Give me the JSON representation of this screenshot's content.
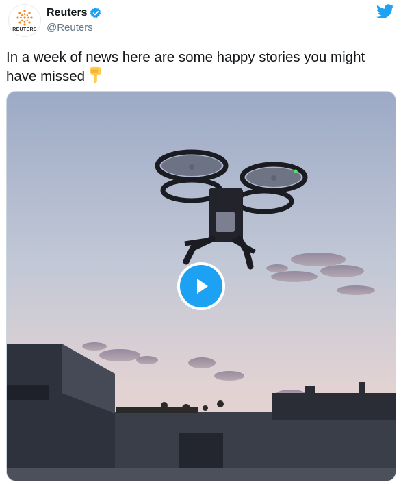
{
  "tweet": {
    "display_name": "Reuters",
    "handle": "@Reuters",
    "avatar_text": "REUTERS",
    "verified": true,
    "text": "In a week of news here are some happy stories you might have missed",
    "emoji": "backhand-index-pointing-down"
  },
  "media": {
    "type": "video",
    "state": "paused"
  },
  "colors": {
    "twitter_blue": "#1da1f2",
    "reuters_orange": "#f08a24",
    "text_primary": "#14171a",
    "text_secondary": "#657786"
  },
  "icons": [
    "twitter-bird-icon",
    "verified-badge-icon",
    "play-icon",
    "pointing-down-emoji-icon"
  ]
}
